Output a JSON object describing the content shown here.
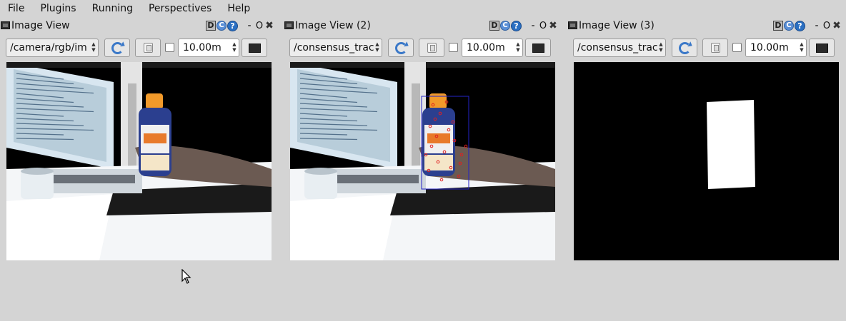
{
  "menubar": {
    "items": [
      "File",
      "Plugins",
      "Running",
      "Perspectives",
      "Help"
    ]
  },
  "panels": [
    {
      "title": "Image View",
      "topic": "/camera/rgb/im",
      "timeout": "10.00m",
      "title_buttons": {
        "d": "D",
        "c": "C",
        "q": "?",
        "dash": "-",
        "o": "O",
        "x": "✖"
      },
      "view_type": "camera"
    },
    {
      "title": "Image View (2)",
      "topic": "/consensus_trac",
      "timeout": "10.00m",
      "title_buttons": {
        "d": "D",
        "c": "C",
        "q": "?",
        "dash": "-",
        "o": "O",
        "x": "✖"
      },
      "view_type": "tracked"
    },
    {
      "title": "Image View (3)",
      "topic": "/consensus_trac",
      "timeout": "10.00m",
      "title_buttons": {
        "d": "D",
        "c": "C",
        "q": "?",
        "dash": "-",
        "o": "O",
        "x": "✖"
      },
      "view_type": "mask"
    }
  ],
  "icons": {
    "panel_icon": "window-icon",
    "refresh": "refresh-icon",
    "save": "save-icon",
    "color": "color-scheme-icon",
    "cursor": "mouse-cursor-icon"
  },
  "colors": {
    "background": "#d4d4d4",
    "help_blue": "#2a6fc2",
    "track_box": "#2323c8",
    "keypoints": "#e02020"
  }
}
